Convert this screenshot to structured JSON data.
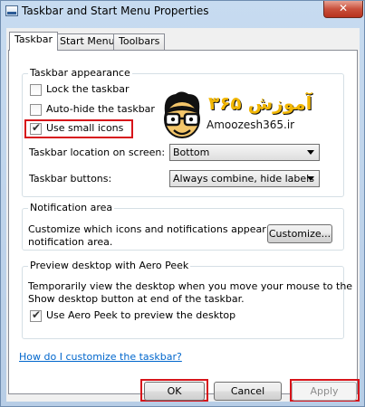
{
  "window": {
    "title": "Taskbar and Start Menu Properties",
    "close_label": "✕"
  },
  "tabs": [
    {
      "label": "Taskbar"
    },
    {
      "label": "Start Menu"
    },
    {
      "label": "Toolbars"
    }
  ],
  "appearance": {
    "legend": "Taskbar appearance",
    "lock_label": "Lock the taskbar",
    "lock_checked": false,
    "autohide_label": "Auto-hide the taskbar",
    "autohide_checked": false,
    "small_icons_label": "Use small icons",
    "small_icons_checked": true,
    "location_label": "Taskbar location on screen:",
    "location_value": "Bottom",
    "buttons_label": "Taskbar buttons:",
    "buttons_value": "Always combine, hide labels"
  },
  "logo": {
    "fa_text": "آموزش ۳۶۵",
    "en_text": "Amoozesh365.ir"
  },
  "notification": {
    "legend": "Notification area",
    "desc_line1": "Customize which icons and notifications appear in the",
    "desc_line2": "notification area.",
    "customize_label": "Customize..."
  },
  "aero_peek": {
    "legend": "Preview desktop with Aero Peek",
    "desc_line1": "Temporarily view the desktop when you move your mouse to the",
    "desc_line2": "Show desktop button at end of the taskbar.",
    "checkbox_label": "Use Aero Peek to preview the desktop",
    "checked": true
  },
  "help_link": "How do I customize the taskbar?",
  "footer": {
    "ok_label": "OK",
    "cancel_label": "Cancel",
    "apply_label": "Apply"
  },
  "colors": {
    "highlight": "#d7141a",
    "link": "#0066cc",
    "logo_accent": "#f2b705"
  }
}
